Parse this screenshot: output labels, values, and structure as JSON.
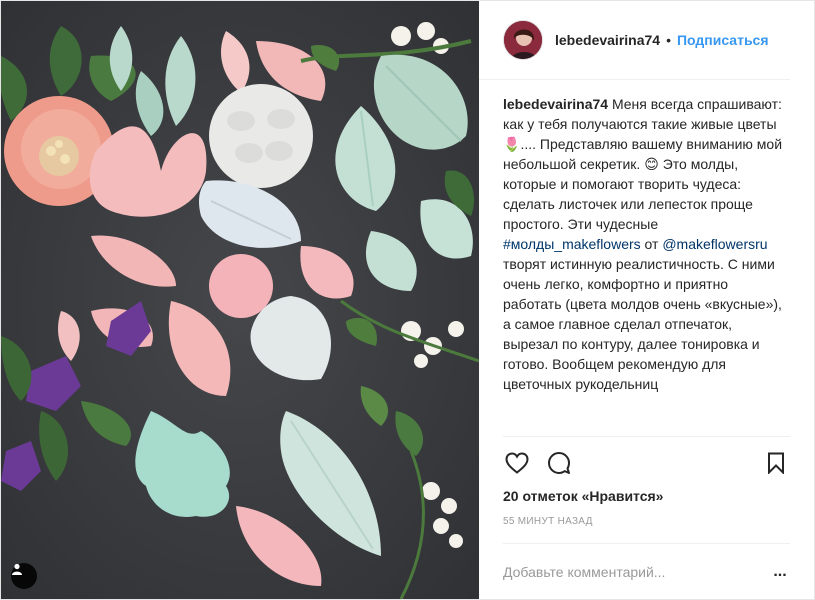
{
  "post": {
    "username": "lebedevairina74",
    "follow_label": "Подписаться",
    "separator": "•",
    "caption": {
      "username": "lebedevairina74",
      "part1": "Меня всегда спрашивают: как у тебя получаются такие живые цветы ",
      "emoji1": "🌷",
      "part2": ".... Представляю вашему вниманию мой небольшой секретик. ",
      "emoji2": "😊",
      "part3": " Это молды, которые и помогают творить чудеса: сделать листочек или лепесток проще простого. Эти чудесные ",
      "hashtag": "#молды_makeflowers",
      "part4": " от ",
      "mention": "@makeflowersru",
      "part5": " творят истинную реалистичность. С ними очень легко, комфортно и приятно работать (цвета молдов очень «вкусные»), а самое главное сделал отпечаток, вырезал по контуру, далее тонировка и готово. Вообщем рекомендую для цветочных рукодельниц"
    },
    "likes": "20 отметок «Нравится»",
    "time": "55 минут назад",
    "comment_placeholder": "Добавьте комментарий...",
    "more": "..."
  },
  "icons": {
    "like": "heart-icon",
    "comment": "comment-icon",
    "save": "bookmark-icon",
    "tag": "user-tag-icon"
  },
  "colors": {
    "accent": "#3897f0",
    "link": "#003569",
    "background_photo": "#3a3c40"
  }
}
